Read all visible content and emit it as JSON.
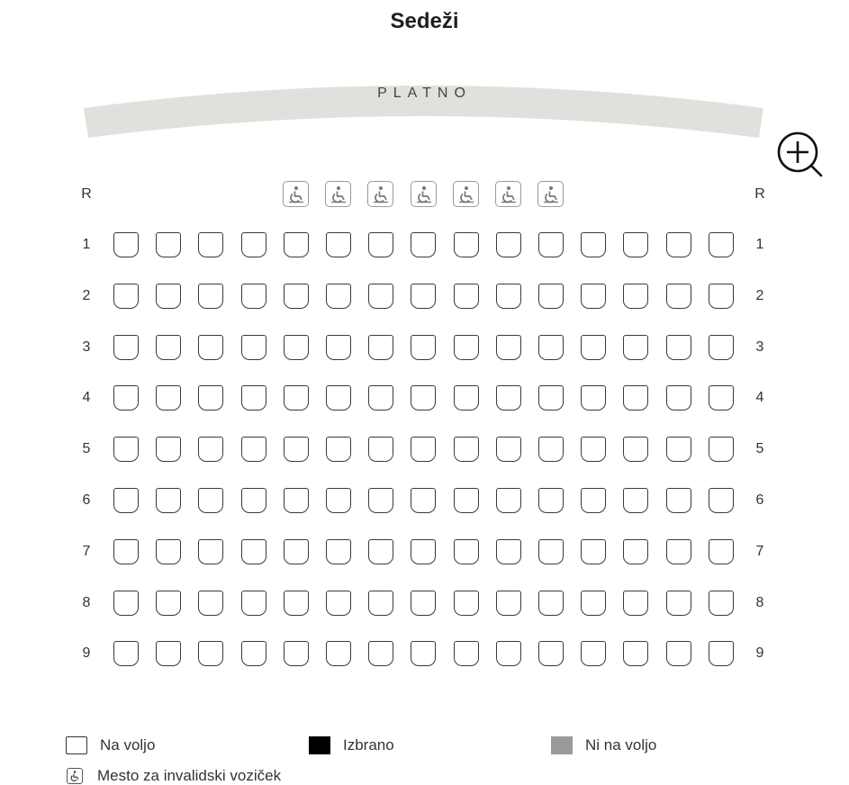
{
  "header": {
    "title": "Sedeži"
  },
  "screen": {
    "label": "PLATNO"
  },
  "row_header": "R",
  "rows": [
    "1",
    "2",
    "3",
    "4",
    "5",
    "6",
    "7",
    "8",
    "9"
  ],
  "seats_per_row": 15,
  "wheelchair_seat_count": 7,
  "legend": {
    "available": "Na voljo",
    "selected": "Izbrano",
    "unavailable": "Ni na voljo",
    "wheelchair": "Mesto za invalidski voziček"
  },
  "icons": {
    "zoom": "zoom-in-icon",
    "wheelchair": "wheelchair-icon"
  },
  "colors": {
    "screen": "#e0e0dc",
    "seat_border": "#3a3a3a",
    "selected": "#000000",
    "unavailable": "#999999"
  }
}
